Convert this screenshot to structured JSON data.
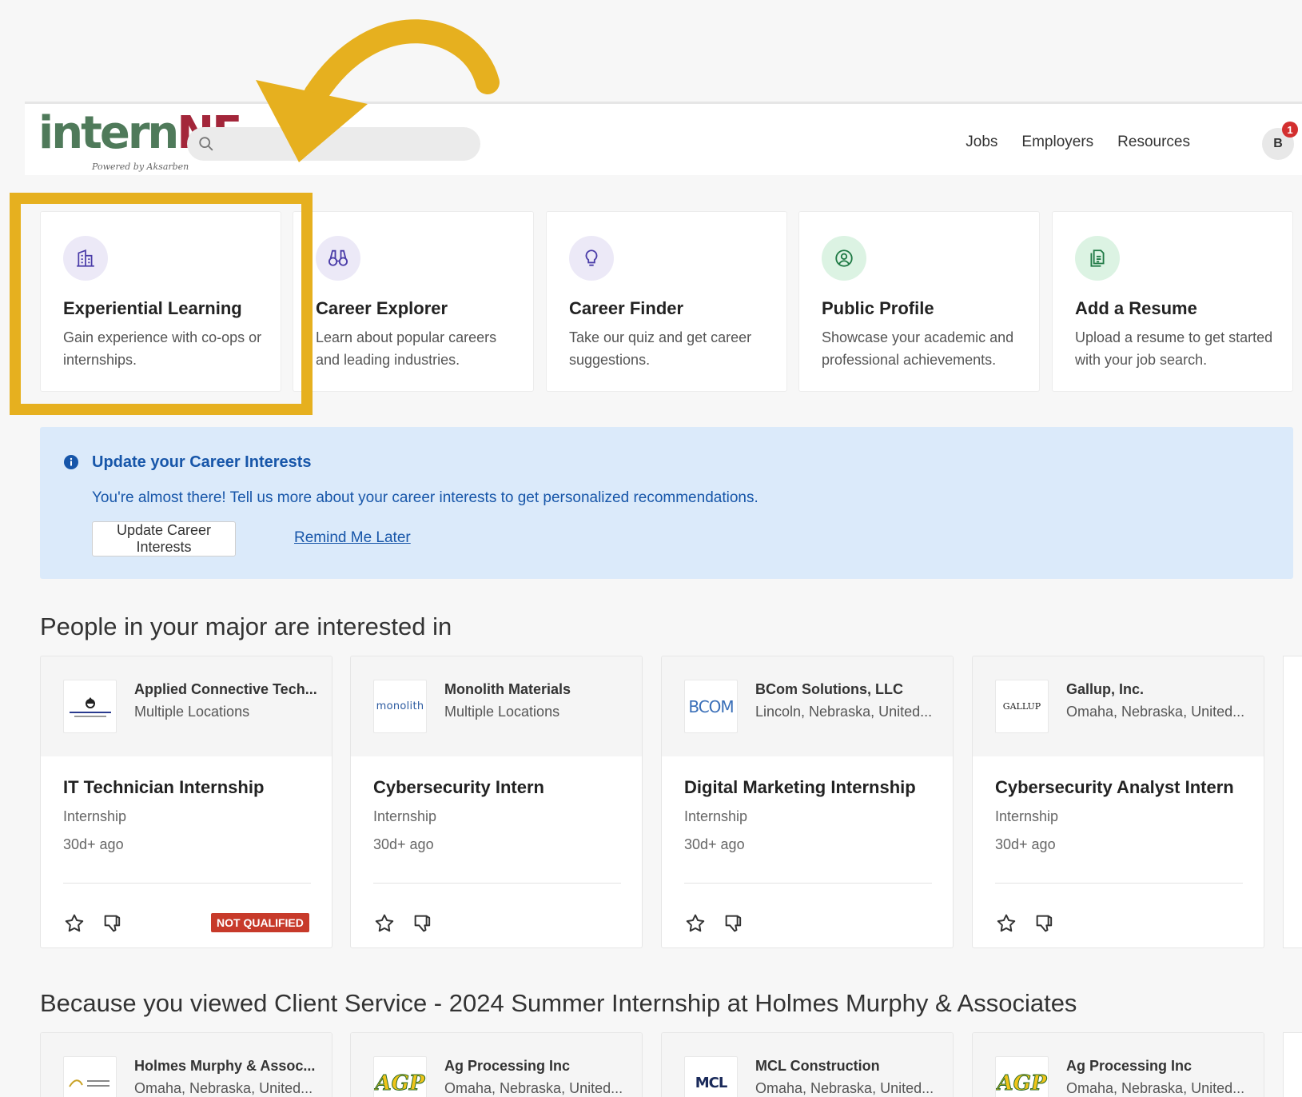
{
  "header": {
    "logo_main_a": "intern",
    "logo_main_b": "NE",
    "logo_sub": "Powered by Aksarben",
    "search_value": "",
    "nav": [
      "Jobs",
      "Employers",
      "Resources"
    ],
    "avatar_initial": "B",
    "notification_count": "1"
  },
  "colors": {
    "highlight": "#e6b01f",
    "link": "#1756a9",
    "banner_bg": "#dbeafa",
    "not_qualified": "#c73a2a"
  },
  "features": [
    {
      "icon": "building-icon",
      "title": "Experiential Learning",
      "desc": "Gain experience with co-ops or internships."
    },
    {
      "icon": "binoculars-icon",
      "title": "Career Explorer",
      "desc": "Learn about popular careers and leading industries."
    },
    {
      "icon": "lightbulb-icon",
      "title": "Career Finder",
      "desc": "Take our quiz and get career suggestions."
    },
    {
      "icon": "profile-icon",
      "title": "Public Profile",
      "desc": "Showcase your academic and professional achievements."
    },
    {
      "icon": "document-icon",
      "title": "Add a Resume",
      "desc": "Upload a resume to get started with your job search."
    }
  ],
  "banner": {
    "title": "Update your Career Interests",
    "text": "You're almost there! Tell us more about your career interests to get personalized recommendations.",
    "button": "Update Career Interests",
    "link": "Remind Me Later"
  },
  "section1": {
    "title": "People in your major are interested in",
    "jobs": [
      {
        "logo": "ACT",
        "company": "Applied Connective Tech...",
        "location": "Multiple Locations",
        "title": "IT Technician Internship",
        "type": "Internship",
        "age": "30d+ ago",
        "badge": "NOT QUALIFIED"
      },
      {
        "logo": "monolith",
        "company": "Monolith Materials",
        "location": "Multiple Locations",
        "title": "Cybersecurity Intern",
        "type": "Internship",
        "age": "30d+ ago",
        "badge": ""
      },
      {
        "logo": "BCOM",
        "company": "BCom Solutions, LLC",
        "location": "Lincoln, Nebraska, United...",
        "title": "Digital Marketing Internship",
        "type": "Internship",
        "age": "30d+ ago",
        "badge": ""
      },
      {
        "logo": "GALLUP",
        "company": "Gallup, Inc.",
        "location": "Omaha, Nebraska, United...",
        "title": "Cybersecurity Analyst Intern",
        "type": "Internship",
        "age": "30d+ ago",
        "badge": ""
      }
    ]
  },
  "section2": {
    "title": "Because you viewed Client Service - 2024 Summer Internship at Holmes Murphy & Associates",
    "companies": [
      {
        "logo": "HOLMES MURPHY",
        "company": "Holmes Murphy & Assoc...",
        "location": "Omaha, Nebraska, United..."
      },
      {
        "logo": "AGP",
        "company": "Ag Processing Inc",
        "location": "Omaha, Nebraska, United..."
      },
      {
        "logo": "MCL",
        "company": "MCL Construction",
        "location": "Omaha, Nebraska, United..."
      },
      {
        "logo": "AGP",
        "company": "Ag Processing Inc",
        "location": "Omaha, Nebraska, United..."
      }
    ]
  }
}
